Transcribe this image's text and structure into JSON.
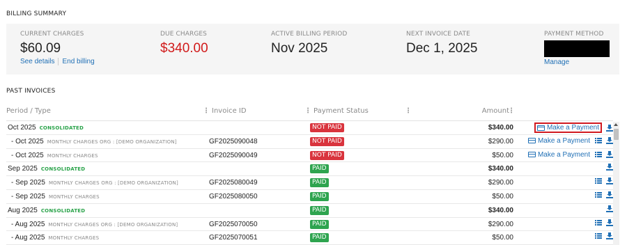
{
  "billing_summary": {
    "title": "BILLING SUMMARY",
    "current_charges": {
      "label": "CURRENT CHARGES",
      "value": "$60.09",
      "link1": "See details",
      "link2": "End billing"
    },
    "due_charges": {
      "label": "DUE CHARGES",
      "value": "$340.00"
    },
    "active_period": {
      "label": "ACTIVE BILLING PERIOD",
      "value": "Nov 2025"
    },
    "next_invoice": {
      "label": "NEXT INVOICE DATE",
      "value": "Dec 1, 2025"
    },
    "payment_method": {
      "label": "PAYMENT METHOD",
      "link": "Manage"
    }
  },
  "invoices": {
    "title": "PAST INVOICES",
    "headers": {
      "period": "Period / Type",
      "invoice": "Invoice ID",
      "status": "Payment Status",
      "amount": "Amount"
    },
    "pay_label": "Make a Payment",
    "rows": [
      {
        "period": "Oct 2025",
        "type": "CONSOLIDATED",
        "invoice": "",
        "status": "NOT PAID",
        "amount": "$340.00"
      },
      {
        "period": "- Oct 2025",
        "type": "MONTHLY CHARGES ORG : [DEMO ORGANIZATION]",
        "invoice": "GF2025090048",
        "status": "NOT PAID",
        "amount": "$290.00"
      },
      {
        "period": "- Oct 2025",
        "type": "MONTHLY CHARGES",
        "invoice": "GF2025090049",
        "status": "NOT PAID",
        "amount": "$50.00"
      },
      {
        "period": "Sep 2025",
        "type": "CONSOLIDATED",
        "invoice": "",
        "status": "PAID",
        "amount": "$340.00"
      },
      {
        "period": "- Sep 2025",
        "type": "MONTHLY CHARGES ORG : [DEMO ORGANIZATION]",
        "invoice": "GF2025080049",
        "status": "PAID",
        "amount": "$290.00"
      },
      {
        "period": "- Sep 2025",
        "type": "MONTHLY CHARGES",
        "invoice": "GF2025080050",
        "status": "PAID",
        "amount": "$50.00"
      },
      {
        "period": "Aug 2025",
        "type": "CONSOLIDATED",
        "invoice": "",
        "status": "PAID",
        "amount": "$340.00"
      },
      {
        "period": "- Aug 2025",
        "type": "MONTHLY CHARGES ORG : [DEMO ORGANIZATION]",
        "invoice": "GF2025070050",
        "status": "PAID",
        "amount": "$290.00"
      },
      {
        "period": "- Aug 2025",
        "type": "MONTHLY CHARGES",
        "invoice": "GF2025070051",
        "status": "PAID",
        "amount": "$50.00"
      }
    ]
  },
  "colors": {
    "accent": "#1f6fb5",
    "due": "#d11a1a",
    "paid": "#2ea44f",
    "not_paid": "#d9343d",
    "highlight": "#d1191f"
  }
}
